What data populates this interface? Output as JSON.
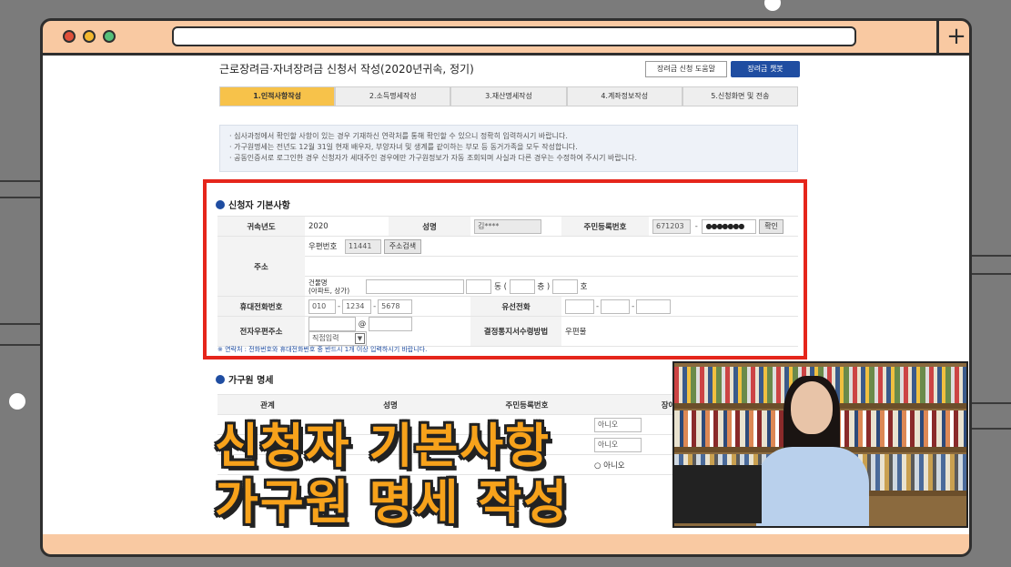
{
  "page": {
    "title": "근로장려금·자녀장려금 신청서 작성(2020년귀속, 정기)",
    "help_button": "장려금 신청 도움말",
    "chatbot_button": "장려금 챗봇"
  },
  "steps": [
    {
      "label": "1.인적사항작성",
      "active": true
    },
    {
      "label": "2.소득명세작성",
      "active": false
    },
    {
      "label": "3.재산명세작성",
      "active": false
    },
    {
      "label": "4.계좌정보작성",
      "active": false
    },
    {
      "label": "5.신청화면 및 전송",
      "active": false
    }
  ],
  "notice": [
    "· 심사과정에서 확인할 사항이 있는 경우 기재하신 연락처를 통해 확인할 수 있으니 정확히 입력하시기 바랍니다.",
    "· 가구원명세는 전년도 12월 31일 현재 배우자, 부양자녀 및 생계를 같이하는 부모 등 동거가족을 모두 작성합니다.",
    "· 공동인증서로 로그인한 경우 신청자가 세대주인 경우에만 가구원정보가 자동 조회되며 사실과 다른 경우는 수정하여 주시기 바랍니다."
  ],
  "applicant": {
    "section_title": "신청자 기본사항",
    "year_label": "귀속년도",
    "year_value": "2020",
    "name_label": "성명",
    "name_value": "김****",
    "rrn_label": "주민등록번호",
    "rrn_front": "671203",
    "rrn_back": "●●●●●●●",
    "confirm_button": "확인",
    "address_label": "주소",
    "postal_label": "우편번호",
    "postal_value": "11441",
    "address_search_button": "주소검색",
    "building_label": "건물명\n(아파트, 상가)",
    "dong_label": "동 (",
    "floor_label": "층 )",
    "ho_label": "호",
    "mobile_label": "휴대전화번호",
    "mobile_1": "010",
    "mobile_2": "1234",
    "mobile_3": "5678",
    "landline_label": "유선전화",
    "email_label": "전자우편주소",
    "email_at": "@",
    "email_domain_select": "직접입력",
    "delivery_label": "결정통지서수령방법",
    "delivery_value": "우편물",
    "footnote": "※ 연락처 : 전화번호와 휴대전화번호 중 반드시 1개 이상 입력하시기 바랍니다."
  },
  "household": {
    "section_title": "가구원 명세",
    "col_relation": "관계",
    "col_name": "성명",
    "col_rrn": "주민등록번호",
    "col_disabled": "장애인/상",
    "row1_value": "아니오",
    "row2_value": "아니오",
    "radio_no": "아니오"
  },
  "caption": {
    "line1": "신청자 기본사항",
    "line2": "가구원 명세 작성"
  },
  "colors": {
    "frame": "#f9c9a2",
    "highlight": "#e5251b",
    "caption": "#f7a21b",
    "active_step": "#f7c24a",
    "brand_blue": "#1f4da1"
  },
  "icons": [
    "window-close-dot",
    "window-minimize-dot",
    "window-maximize-dot",
    "plus-icon",
    "section-bullet-icon",
    "select-arrow-icon"
  ]
}
